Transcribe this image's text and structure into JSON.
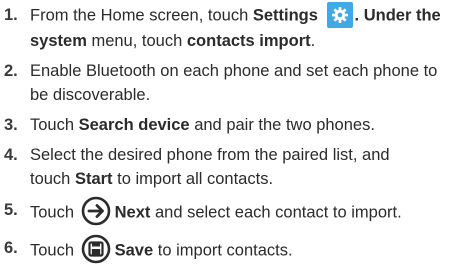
{
  "steps": [
    {
      "num": "1.",
      "t1": "From the Home screen, touch ",
      "t1b": "Settings",
      "t1c": ". Under the",
      "t2b": "system",
      "t2": " menu, touch ",
      "t2c": "contacts import",
      "t2d": ".",
      "icon": "settings-gear-icon"
    },
    {
      "num": "2.",
      "l1": "Enable Bluetooth on each phone and set each phone to",
      "l2": "be discoverable."
    },
    {
      "num": "3.",
      "t1": "Touch ",
      "t1b": "Search device",
      "t1c": " and pair the two phones."
    },
    {
      "num": "4.",
      "l1": "Select the desired phone from the paired list, and",
      "t2": "touch ",
      "t2b": "Start",
      "t2c": " to import all contacts."
    },
    {
      "num": "5.",
      "t1": "Touch ",
      "t1b": "Next",
      "t1c": " and select each contact to import.",
      "icon": "next-arrow-icon"
    },
    {
      "num": "6.",
      "t1": "Touch ",
      "t1b": "Save",
      "t1c": " to import contacts.",
      "icon": "save-disk-icon"
    }
  ],
  "colors": {
    "settings_icon_bg": "#41a9e6",
    "icon_dark": "#2b2b2b",
    "text": "#2b2b2b"
  }
}
